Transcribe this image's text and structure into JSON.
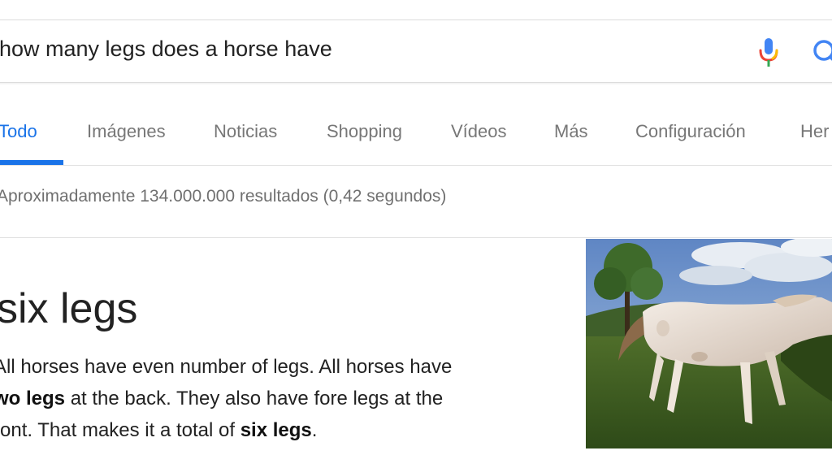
{
  "search": {
    "query": "how many legs does a horse have"
  },
  "tabs": [
    {
      "label": "Todo",
      "active": true
    },
    {
      "label": "Imágenes"
    },
    {
      "label": "Noticias"
    },
    {
      "label": "Shopping"
    },
    {
      "label": "Vídeos"
    },
    {
      "label": "Más"
    },
    {
      "label": "Configuración"
    },
    {
      "label": "Her"
    }
  ],
  "results": {
    "stats": "Aproximadamente 134.000.000 resultados (0,42 segundos)"
  },
  "answer": {
    "title": "six legs",
    "line1": "All horses have even number of legs. All horses have",
    "line2_bold": "wo legs",
    "line2_rest": " at the back. They also have fore legs at the",
    "line3_start": "ront. That makes it a total of ",
    "line3_bold": "six legs",
    "line3_end": "."
  },
  "colors": {
    "accent": "#1a73e8",
    "text": "#222222",
    "muted": "#777777"
  },
  "icons": {
    "mic": "microphone-icon",
    "search": "search-icon"
  }
}
